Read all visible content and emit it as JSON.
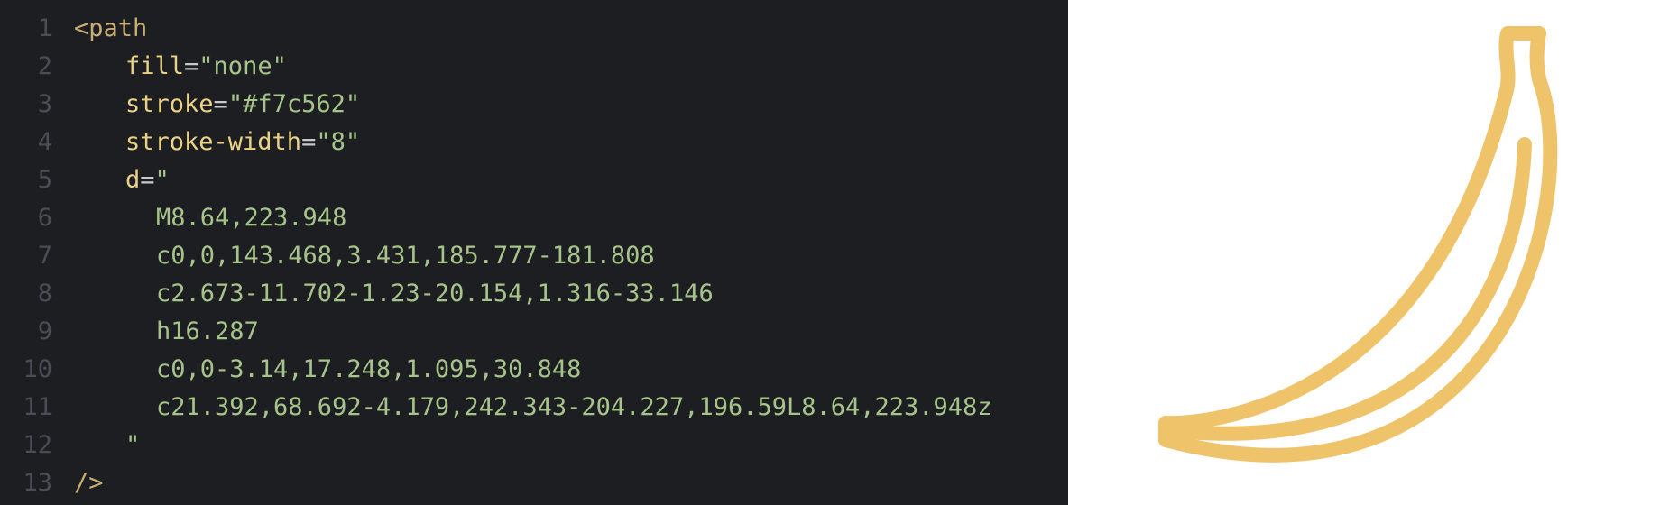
{
  "editor": {
    "lines": [
      {
        "n": "1",
        "tag": "<path"
      },
      {
        "n": "2",
        "attr": "fill",
        "eq": "=",
        "val": "\"none\""
      },
      {
        "n": "3",
        "attr": "stroke",
        "eq": "=",
        "val": "\"#f7c562\""
      },
      {
        "n": "4",
        "attr": "stroke-width",
        "eq": "=",
        "val": "\"8\""
      },
      {
        "n": "5",
        "attr": "d",
        "eq": "=",
        "val": "\""
      },
      {
        "n": "6",
        "path": "M8.64,223.948"
      },
      {
        "n": "7",
        "path": "c0,0,143.468,3.431,185.777-181.808"
      },
      {
        "n": "8",
        "path": "c2.673-11.702-1.23-20.154,1.316-33.146"
      },
      {
        "n": "9",
        "path": "h16.287"
      },
      {
        "n": "10",
        "path": "c0,0-3.14,17.248,1.095,30.848"
      },
      {
        "n": "11",
        "path": "c21.392,68.692-4.179,242.343-204.227,196.59L8.64,223.948z"
      },
      {
        "n": "12",
        "quote": "\""
      },
      {
        "n": "13",
        "tag": "/>"
      }
    ]
  },
  "preview": {
    "stroke_color": "#efc36a",
    "shape": "banana-outline"
  }
}
